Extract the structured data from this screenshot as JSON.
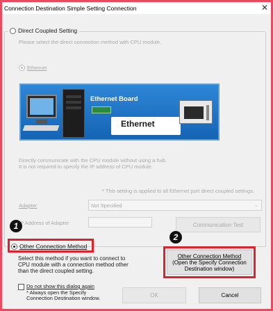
{
  "window": {
    "title": "Connection Destination Simple Setting Connection",
    "close_glyph": "✕"
  },
  "direct": {
    "radio_label": "Direct Coupled Setting",
    "checked": false,
    "description": "Please select the direct connection method with CPU module.",
    "ethernet_label": "Ethernet",
    "illustration": {
      "board_label": "Ethernet Board",
      "cable_label": "Ethernet"
    },
    "hub_line1": "Directly communicate with the CPU module without using a hub.",
    "hub_line2": "It is not required to specify the IP address of CPU module.",
    "note": "* This setting is applied to all Ethernet port direct coupled settings.",
    "adapter_label": "Adapter",
    "adapter_value": "Not Specified",
    "ip_label": "IP Address of Adapter",
    "ip_value": "",
    "comm_test_label": "Communication Test"
  },
  "other": {
    "radio_label": "Other Connection Method",
    "checked": true,
    "description_line1": "Select this method if you want to connect to",
    "description_line2": "CPU module with a connection method other",
    "description_line3": "than the direct coupled setting.",
    "button_line1": "Other Connection Method",
    "button_line2": "(Open the Specify Connection",
    "button_line3": "Destination window)"
  },
  "footer": {
    "checkbox_line1": "Do not show this dialog again",
    "checkbox_line2": "* Always open the Specify",
    "checkbox_line3": "Connection Destination window.",
    "checkbox_checked": false,
    "ok_label": "OK",
    "cancel_label": "Cancel"
  },
  "callouts": {
    "badge1": "1",
    "badge2": "2",
    "highlight_color": "#e0202a"
  }
}
